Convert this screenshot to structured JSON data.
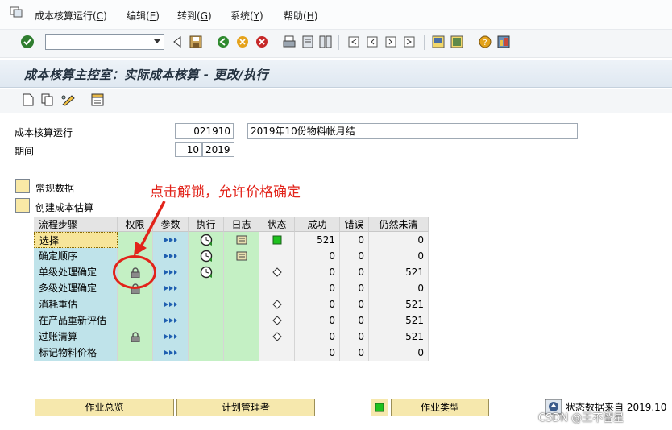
{
  "menu": {
    "items": [
      {
        "label": "成本核算运行(",
        "key": "C",
        "close": ")"
      },
      {
        "label": "编辑(",
        "key": "E",
        "close": ")"
      },
      {
        "label": "转到(",
        "key": "G",
        "close": ")"
      },
      {
        "label": "系统(",
        "key": "Y",
        "close": ")"
      },
      {
        "label": "帮助(",
        "key": "H",
        "close": ")"
      }
    ]
  },
  "title": "成本核算主控室：实际成本核算 - 更改/执行",
  "form": {
    "run_label": "成本核算运行",
    "run_id": "021910",
    "run_desc": "2019年10份物料帐月结",
    "period_label": "期间",
    "period": "10",
    "year": "2019"
  },
  "sections": {
    "general_data": "常规数据",
    "create_estimate": "创建成本估算"
  },
  "annotation": "点击解锁，允许价格确定",
  "grid": {
    "headers": [
      "流程步骤",
      "权限",
      "参数",
      "执行",
      "日志",
      "状态",
      "成功",
      "错误",
      "仍然未清"
    ],
    "rows": [
      {
        "step": "选择",
        "success": "521",
        "errors": "0",
        "open": "0"
      },
      {
        "step": "确定顺序",
        "success": "0",
        "errors": "0",
        "open": "0"
      },
      {
        "step": "单级处理确定",
        "success": "0",
        "errors": "0",
        "open": "521"
      },
      {
        "step": "多级处理确定",
        "success": "0",
        "errors": "0",
        "open": "0"
      },
      {
        "step": "消耗重估",
        "success": "0",
        "errors": "0",
        "open": "521"
      },
      {
        "step": "在产品重新评估",
        "success": "0",
        "errors": "0",
        "open": "521"
      },
      {
        "step": "过账清算",
        "success": "0",
        "errors": "0",
        "open": "521"
      },
      {
        "step": "标记物料价格",
        "success": "0",
        "errors": "0",
        "open": "0"
      }
    ]
  },
  "buttons": {
    "job_overview": "作业总览",
    "planning_manager": "计划管理者",
    "job_type": "作业类型"
  },
  "status_text": "状态数据来自 2019.10",
  "watermark": "CSDN @王不留星",
  "colors": {
    "title_text": "#23313f",
    "step_bg": "#bfe3ea",
    "selected_step_bg": "#f7e59a",
    "green_col_bg": "#c4f0c4",
    "annotation_red": "#e2231a"
  }
}
